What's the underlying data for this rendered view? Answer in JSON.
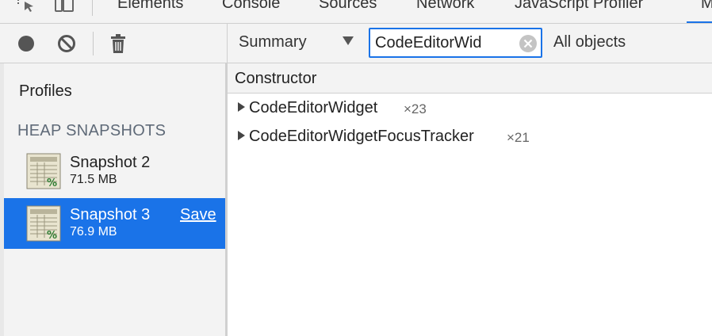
{
  "tabs": [
    {
      "label": "Elements"
    },
    {
      "label": "Console"
    },
    {
      "label": "Sources"
    },
    {
      "label": "Network"
    },
    {
      "label": "JavaScript Profiler"
    },
    {
      "label": "M"
    }
  ],
  "toolbar": {
    "view_mode": "Summary",
    "filter": {
      "value": "CodeEditorWid",
      "placeholder": "Class filter"
    },
    "object_scope": "All objects"
  },
  "sidebar": {
    "title": "Profiles",
    "section": "HEAP SNAPSHOTS",
    "snapshots": [
      {
        "name": "Snapshot 2",
        "size": "71.5 MB"
      },
      {
        "name": "Snapshot 3",
        "size": "76.9 MB",
        "action": "Save"
      }
    ]
  },
  "grid": {
    "column": "Constructor",
    "rows": [
      {
        "name": "CodeEditorWidget",
        "count": "×23"
      },
      {
        "name": "CodeEditorWidgetFocusTracker",
        "count": "×21"
      }
    ]
  },
  "colors": {
    "accent": "#1a73e8",
    "panel": "#f3f3f3"
  },
  "icons": [
    "inspect-icon",
    "device-toggle-icon",
    "record-icon",
    "clear-icon",
    "trash-icon",
    "snapshot-icon",
    "clear-filter-icon",
    "expand-triangle-icon",
    "dropdown-arrow-icon"
  ]
}
